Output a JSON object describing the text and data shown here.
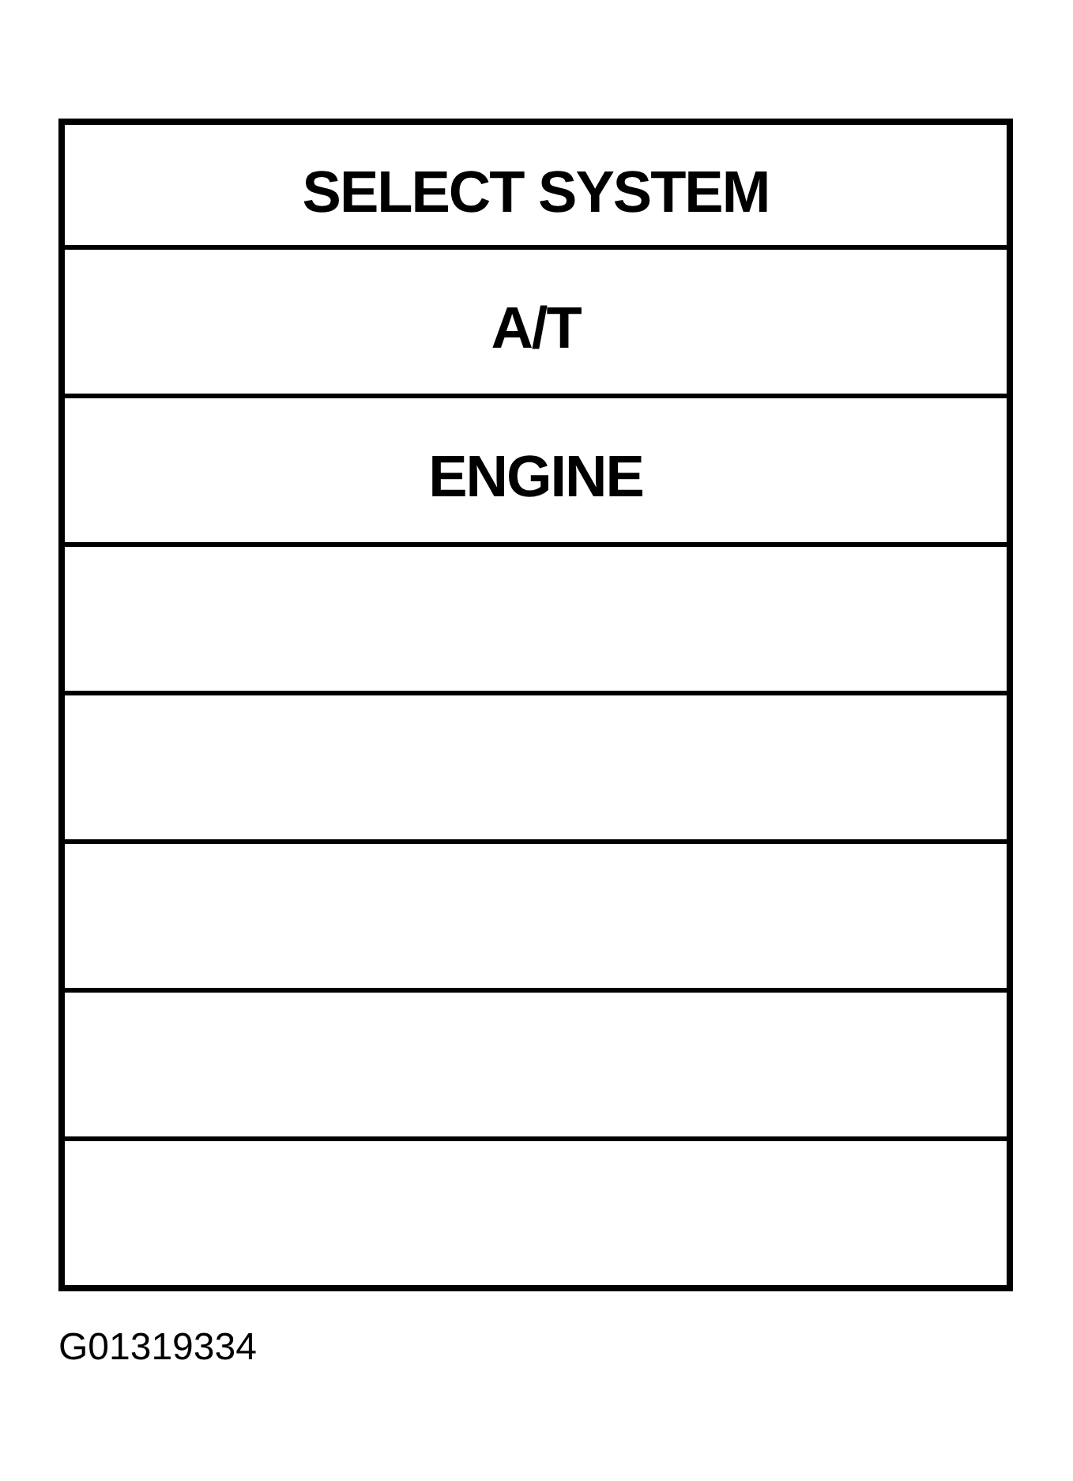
{
  "screen": {
    "title": "SELECT SYSTEM",
    "items": [
      {
        "kind": "option",
        "label": "A/T"
      },
      {
        "kind": "option",
        "label": "ENGINE"
      },
      {
        "kind": "blank"
      },
      {
        "kind": "blank"
      },
      {
        "kind": "blank"
      },
      {
        "kind": "blank"
      },
      {
        "kind": "blank"
      }
    ]
  },
  "figure_id": "G01319334"
}
